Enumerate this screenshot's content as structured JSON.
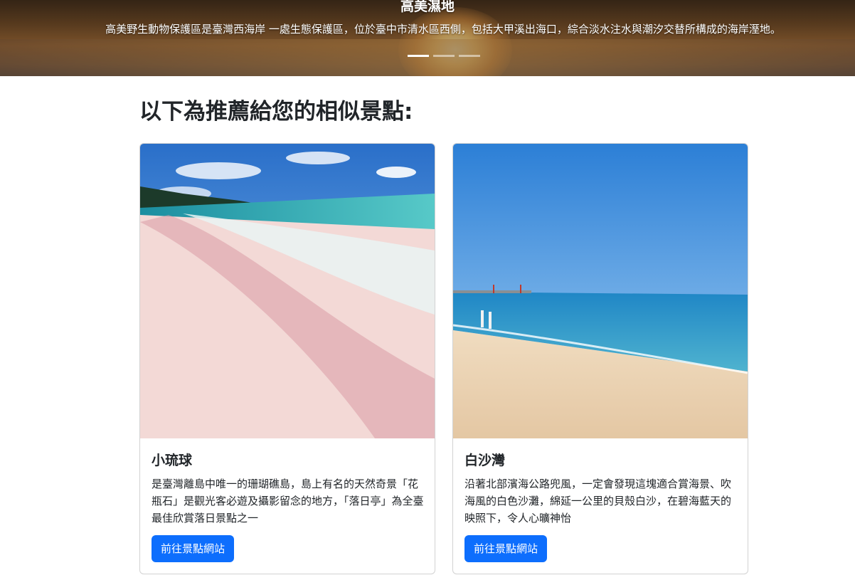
{
  "hero": {
    "title": "高美濕地",
    "caption": "高美野生動物保護區是臺灣西海岸 一處生態保護區，位於臺中市清水區西側，包括大甲溪出海口，綜合淡水注水與潮汐交替所構成的海岸溼地。",
    "indicator_count": 3,
    "active_indicator": 1
  },
  "recommend": {
    "heading": "以下為推薦給您的相似景點:"
  },
  "cards": [
    {
      "title": "小琉球",
      "text": "是臺灣離島中唯一的珊瑚礁島，島上有名的天然奇景「花瓶石」是觀光客必遊及攝影留念的地方，「落日亭」為全臺最佳欣賞落日景點之一",
      "button": "前往景點網站"
    },
    {
      "title": "白沙灣",
      "text": "沿著北部濱海公路兜風，一定會發現這塊適合賞海景、吹海風的白色沙灘，綿延一公里的貝殼白沙，在碧海藍天的映照下，令人心曠神怡",
      "button": "前往景點網站"
    }
  ],
  "colors": {
    "primary": "#0d6efd",
    "text": "#212529"
  }
}
